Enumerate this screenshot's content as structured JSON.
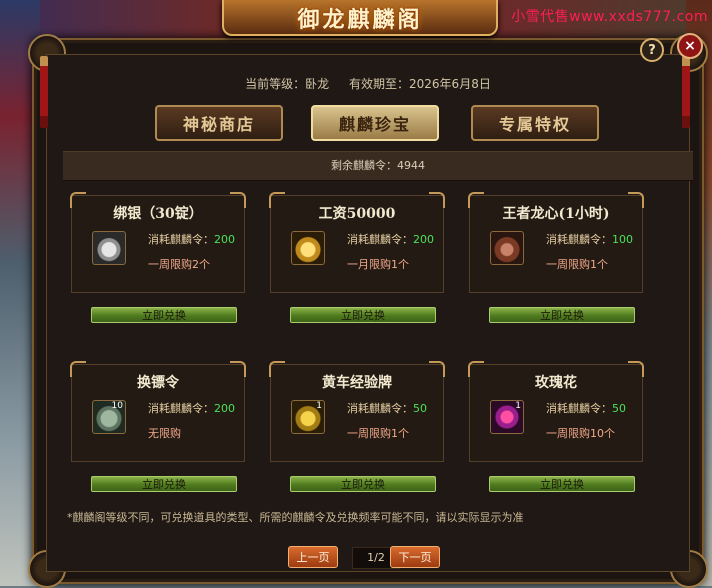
{
  "watermark": "小雪代售www.xxds777.com",
  "window": {
    "title": "御龙麒麟阁",
    "help_label": "?",
    "close_label": "×"
  },
  "info": {
    "level_label": "当前等级：卧龙",
    "expiry_label": "有效期至：2026年6月8日"
  },
  "tabs": [
    {
      "label": "神秘商店",
      "active": false
    },
    {
      "label": "麒麟珍宝",
      "active": true
    },
    {
      "label": "专属特权",
      "active": false
    }
  ],
  "remaining": "剩余麒麟令：4944",
  "cost_prefix": "消耗麒麟令：",
  "redeem_label": "立即兑换",
  "items": [
    {
      "title": "绑银（30锭）",
      "icon": "silver-ingot-icon",
      "count": "",
      "cost": "200",
      "limit": "一周限购2个"
    },
    {
      "title": "工资50000",
      "icon": "gold-box-icon",
      "count": "",
      "cost": "200",
      "limit": "一月限购1个"
    },
    {
      "title": "王者龙心(1小时)",
      "icon": "dragon-heart-icon",
      "count": "",
      "cost": "100",
      "limit": "一周限购1个"
    },
    {
      "title": "换镖令",
      "icon": "escort-token-icon",
      "count": "10",
      "cost": "200",
      "limit": "无限购"
    },
    {
      "title": "黄车经验牌",
      "icon": "yellow-cart-icon",
      "count": "1",
      "cost": "50",
      "limit": "一周限购1个"
    },
    {
      "title": "玫瑰花",
      "icon": "rose-icon",
      "count": "1",
      "cost": "50",
      "limit": "一周限购10个"
    }
  ],
  "note": "*麒麟阁等级不同，可兑换道具的类型、所需的麒麟令及兑换频率可能不同，请以实际显示为准",
  "pager": {
    "prev_label": "上一页",
    "next_label": "下一页",
    "page": "1/2"
  },
  "colors": {
    "accent_gold": "#c59a58",
    "cost_value": "#4be058",
    "limit_text": "#f1a98a",
    "button_green": "#4f7b1f",
    "pager_orange": "#d86b2d",
    "close_red": "#8f1414"
  }
}
